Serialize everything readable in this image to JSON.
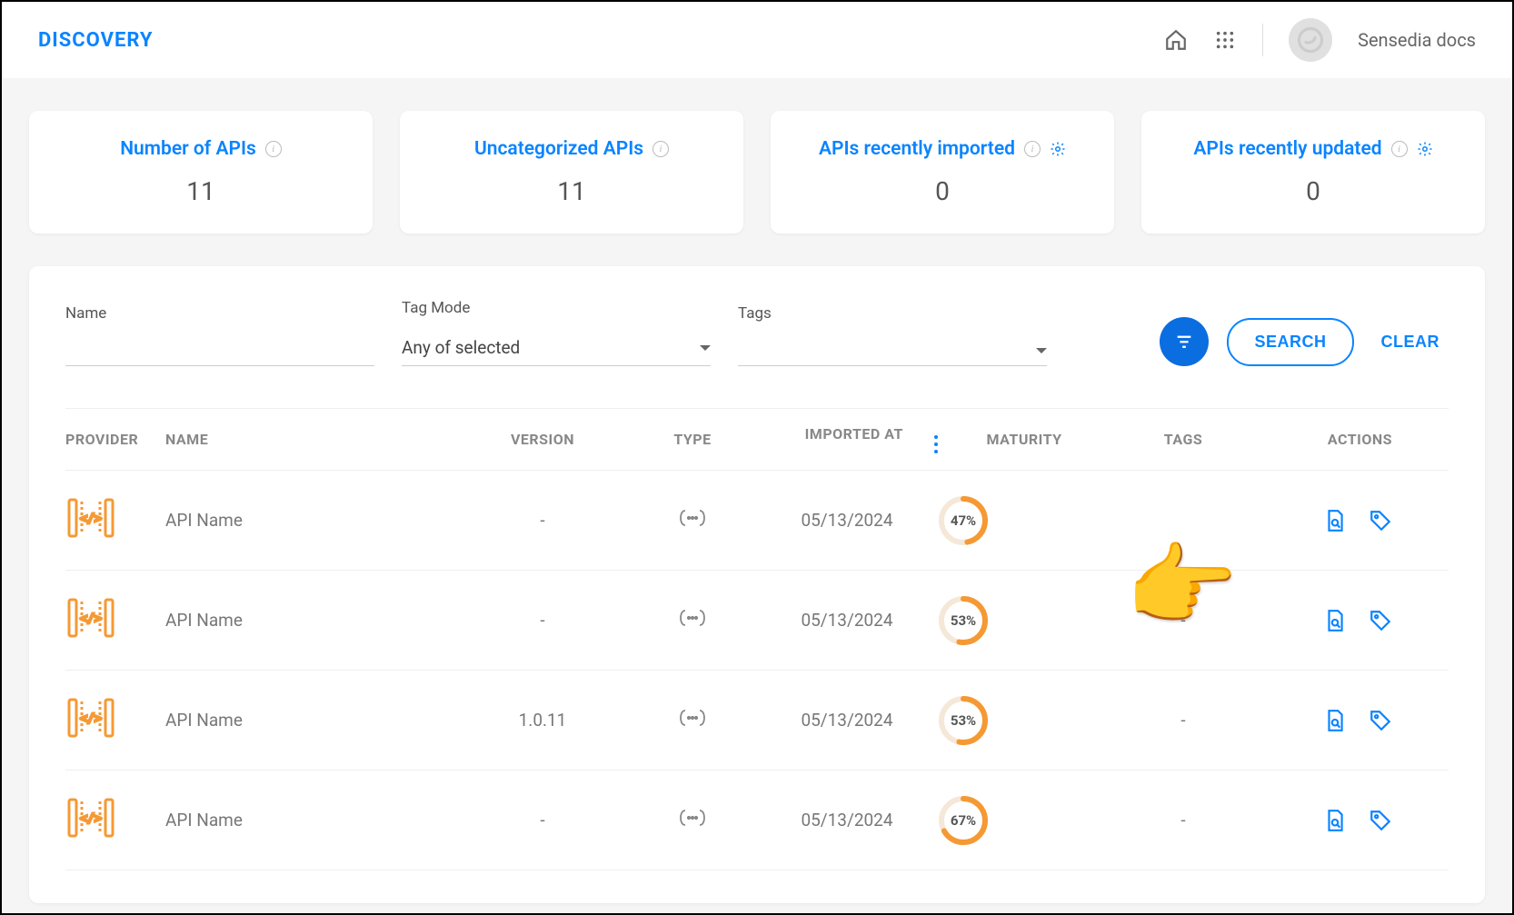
{
  "header": {
    "title": "DISCOVERY",
    "user": "Sensedia docs"
  },
  "stats": [
    {
      "title": "Number of APIs",
      "value": "11",
      "has_gear": false
    },
    {
      "title": "Uncategorized APIs",
      "value": "11",
      "has_gear": false
    },
    {
      "title": "APIs recently imported",
      "value": "0",
      "has_gear": true
    },
    {
      "title": "APIs recently updated",
      "value": "0",
      "has_gear": true
    }
  ],
  "filters": {
    "name_label": "Name",
    "tagmode_label": "Tag Mode",
    "tagmode_value": "Any of selected",
    "tags_label": "Tags",
    "search_label": "SEARCH",
    "clear_label": "CLEAR"
  },
  "columns": {
    "provider": "PROVIDER",
    "name": "NAME",
    "version": "VERSION",
    "type": "TYPE",
    "imported_at": "IMPORTED AT",
    "maturity": "MATURITY",
    "tags": "TAGS",
    "actions": "ACTIONS"
  },
  "rows": [
    {
      "name": "API Name",
      "version": "-",
      "imported_at": "05/13/2024",
      "maturity": 47,
      "tags": ""
    },
    {
      "name": "API Name",
      "version": "-",
      "imported_at": "05/13/2024",
      "maturity": 53,
      "tags": "-"
    },
    {
      "name": "API Name",
      "version": "1.0.11",
      "imported_at": "05/13/2024",
      "maturity": 53,
      "tags": "-"
    },
    {
      "name": "API Name",
      "version": "-",
      "imported_at": "05/13/2024",
      "maturity": 67,
      "tags": "-"
    }
  ]
}
